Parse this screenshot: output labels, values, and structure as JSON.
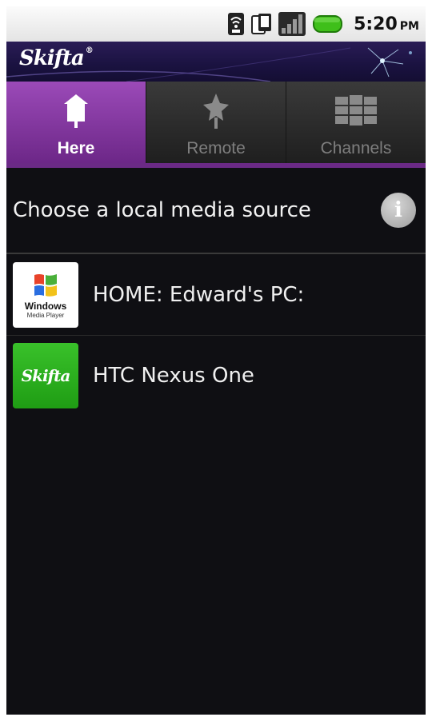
{
  "status_bar": {
    "time": "5:20",
    "ampm": "PM",
    "icons": [
      "wifi-icon",
      "sync-icon",
      "signal-icon",
      "battery-icon"
    ],
    "battery_color": "#3fbf1a"
  },
  "brand": {
    "logo_text": "Skifta",
    "accent": "#2a1c56"
  },
  "tabs": [
    {
      "label": "Here",
      "icon": "house-icon",
      "active": true
    },
    {
      "label": "Remote",
      "icon": "remote-icon",
      "active": false
    },
    {
      "label": "Channels",
      "icon": "grid-icon",
      "active": false
    }
  ],
  "header": {
    "title": "Choose a local media source",
    "info_icon": "i"
  },
  "sources": [
    {
      "label": "HOME: Edward's PC:",
      "icon": "windows-media-player-icon",
      "thumb_line1": "Windows",
      "thumb_line2": "Media Player"
    },
    {
      "label": "HTC Nexus One",
      "icon": "skifta-icon",
      "thumb_text": "Skifta"
    }
  ],
  "colors": {
    "active_tab": "#8a3aa8",
    "background": "#0f0f13"
  }
}
